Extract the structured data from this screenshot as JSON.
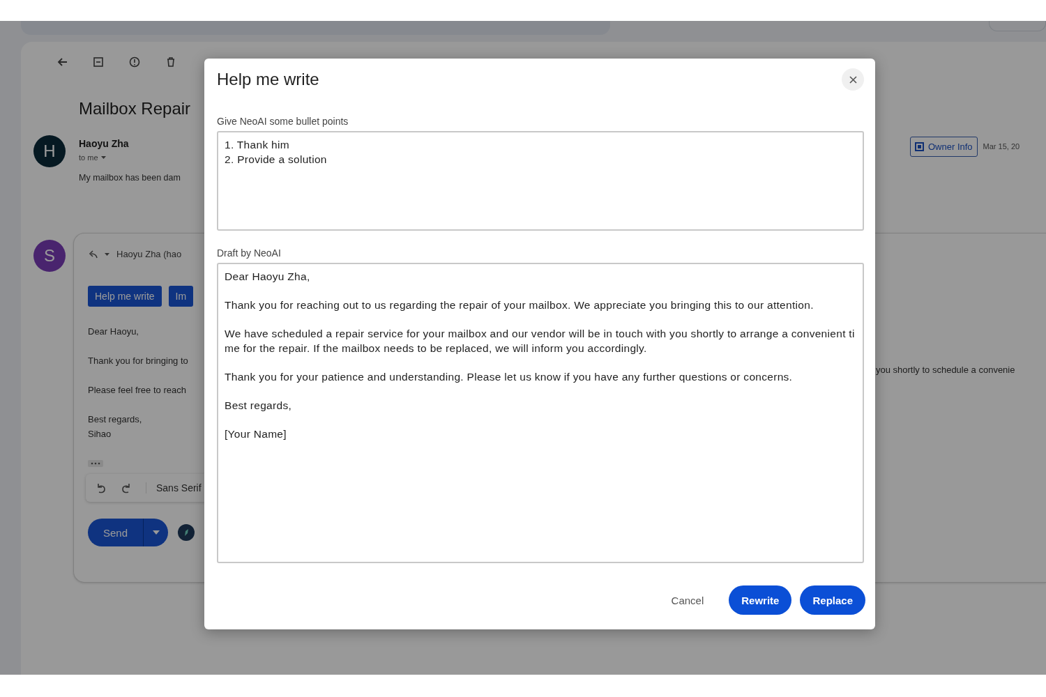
{
  "background": {
    "toolbar": [
      {
        "kind": "back"
      },
      {
        "kind": "archive"
      },
      {
        "kind": "report"
      },
      {
        "kind": "delete"
      }
    ],
    "subject": "Mailbox Repair",
    "message": {
      "avatar_letter": "H",
      "sender": "Haoyu Zha",
      "recipient": "to me",
      "snippet": "My mailbox has been dam",
      "label": "Owner Info",
      "date": "Mar 15, 20"
    },
    "reply": {
      "avatar_letter": "S",
      "to": "Haoyu Zha (hao",
      "ai_buttons": [
        "Help me write",
        "Im"
      ],
      "body": [
        "Dear Haoyu,",
        "Thank you for bringing to",
        "Please feel free to reach"
      ],
      "signature": [
        "Best regards,",
        "Sihao"
      ],
      "continuation": "you shortly to schedule a convenie",
      "font": "Sans Serif",
      "send": "Send"
    }
  },
  "dialog": {
    "title": "Help me write",
    "prompt_label": "Give NeoAI some bullet points",
    "prompt": "1. Thank him\n2. Provide a solution",
    "draft_label": "Draft by NeoAI",
    "draft": "Dear Haoyu Zha,\n\nThank you for reaching out to us regarding the repair of your mailbox. We appreciate you bringing this to our attention.\n\nWe have scheduled a repair service for your mailbox and our vendor will be in touch with you shortly to arrange a convenient time for the repair. If the mailbox needs to be replaced, we will inform you accordingly.\n\nThank you for your patience and understanding. Please let us know if you have any further questions or concerns.\n\nBest regards,\n\n[Your Name]",
    "buttons": [
      {
        "label": "Cancel",
        "kind": "text"
      },
      {
        "label": "Rewrite",
        "kind": "filled"
      },
      {
        "label": "Replace",
        "kind": "filled"
      }
    ]
  }
}
